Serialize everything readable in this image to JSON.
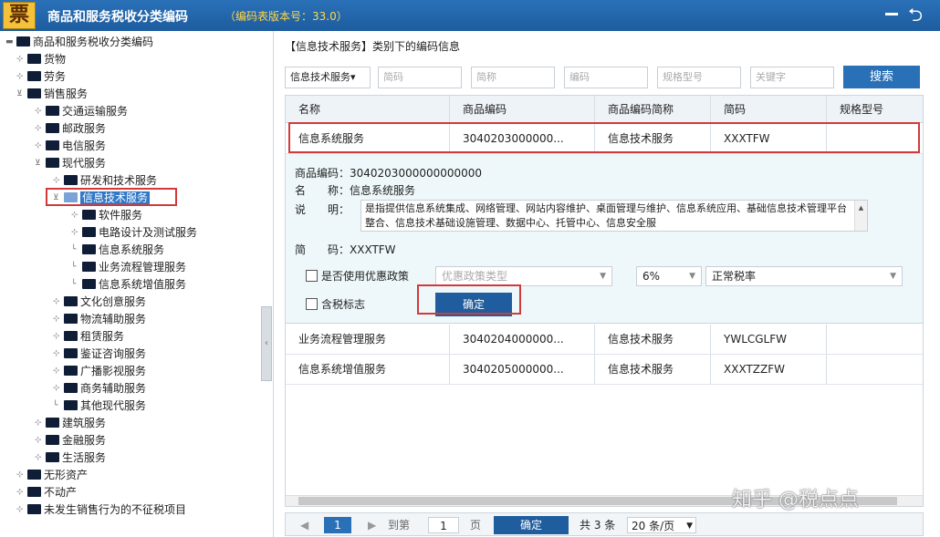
{
  "titlebar": {
    "logo": "票",
    "title": "商品和服务税收分类编码",
    "version": "（编码表版本号：33.0）",
    "back_icon": "back-arrow-icon",
    "minimize_icon": "minimize-icon"
  },
  "tree": {
    "nodes": [
      {
        "label": "商品和服务税收分类编码"
      },
      {
        "label": "货物"
      },
      {
        "label": "劳务"
      },
      {
        "label": "销售服务"
      },
      {
        "label": "交通运输服务"
      },
      {
        "label": "邮政服务"
      },
      {
        "label": "电信服务"
      },
      {
        "label": "现代服务"
      },
      {
        "label": "研发和技术服务"
      },
      {
        "label": "信息技术服务"
      },
      {
        "label": "软件服务"
      },
      {
        "label": "电路设计及测试服务"
      },
      {
        "label": "信息系统服务"
      },
      {
        "label": "业务流程管理服务"
      },
      {
        "label": "信息系统增值服务"
      },
      {
        "label": "文化创意服务"
      },
      {
        "label": "物流辅助服务"
      },
      {
        "label": "租赁服务"
      },
      {
        "label": "鉴证咨询服务"
      },
      {
        "label": "广播影视服务"
      },
      {
        "label": "商务辅助服务"
      },
      {
        "label": "其他现代服务"
      },
      {
        "label": "建筑服务"
      },
      {
        "label": "金融服务"
      },
      {
        "label": "生活服务"
      },
      {
        "label": "无形资产"
      },
      {
        "label": "不动产"
      },
      {
        "label": "未发生销售行为的不征税项目"
      }
    ],
    "splitter_icon": "‹"
  },
  "main": {
    "heading": "【信息技术服务】类别下的编码信息",
    "filters": {
      "category_value": "信息技术服务▾",
      "code_ph": "简码",
      "name_ph": "简称",
      "bm_ph": "编码",
      "spec_ph": "规格型号",
      "keyword_ph": "关键字",
      "search_label": "搜索"
    },
    "columns": [
      "名称",
      "商品编码",
      "商品编码简称",
      "简码",
      "规格型号"
    ],
    "rows": [
      {
        "name": "信息系统服务",
        "code": "3040203000000...",
        "short": "信息技术服务",
        "jm": "XXXTFW",
        "spec": ""
      },
      {
        "name": "业务流程管理服务",
        "code": "3040204000000...",
        "short": "信息技术服务",
        "jm": "YWLCGLFW",
        "spec": ""
      },
      {
        "name": "信息系统增值服务",
        "code": "3040205000000...",
        "short": "信息技术服务",
        "jm": "XXXTZZFW",
        "spec": ""
      }
    ],
    "detail": {
      "code_line": "商品编码：3040203000000000000",
      "name_line": "名　　称：信息系统服务",
      "desc_label": "说　　明：",
      "desc_text": "是指提供信息系统集成、网络管理、网站内容维护、桌面管理与维护、信息系统应用、基础信息技术管理平台整合、信息技术基础设施管理、数据中心、托管中心、信息安全服",
      "jm_line": "简　　码：XXXTFW",
      "policy_label": "是否使用优惠政策",
      "policy_select": "优惠政策类型",
      "rate_select": "6%",
      "tax_type_select": "正常税率",
      "tax_included_label": "含税标志",
      "confirm_label": "确定"
    },
    "pager": {
      "page_current": "1",
      "goto_label": "到第",
      "goto_value": "1",
      "page_unit": "页",
      "confirm_label": "确定",
      "total": "共 3 条",
      "per_page": "20 条/页"
    }
  },
  "watermark": "知乎 @税点点"
}
